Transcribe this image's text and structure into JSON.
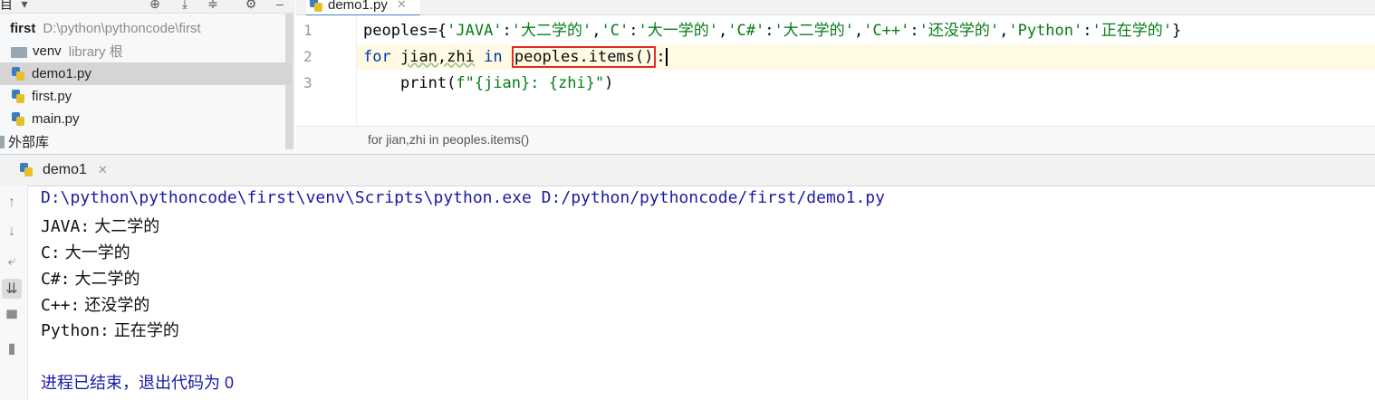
{
  "sidebar": {
    "title_fragment": "项目",
    "items": [
      {
        "label": "first",
        "path": "D:\\python\\pythoncode\\first",
        "type": "project-root"
      },
      {
        "label": "venv",
        "note": "library 根",
        "type": "folder"
      },
      {
        "label": "demo1.py",
        "type": "python-file",
        "selected": true
      },
      {
        "label": "first.py",
        "type": "python-file"
      },
      {
        "label": "main.py",
        "type": "python-file"
      },
      {
        "label": "外部库",
        "type": "external-libraries"
      }
    ],
    "toolbar_icons": [
      "locate-icon",
      "collapse-icon",
      "expand-icon",
      "gear-icon",
      "minimize-icon"
    ]
  },
  "editor": {
    "tab_label": "demo1.py",
    "line_numbers": [
      "1",
      "2",
      "3"
    ],
    "lines": {
      "l1": {
        "var": "peoples={",
        "k1": "'JAVA'",
        "v1": "'大二学的'",
        "k2": "'C'",
        "v2": "'大一学的'",
        "k3": "'C#'",
        "v3": "'大二学的'",
        "k4": "'C++'",
        "v4": "'还没学的'",
        "k5": "'Python'",
        "v5": "'正在学的'",
        "end": "}"
      },
      "l2": {
        "kw_for": "for",
        "vars": "jian,zhi",
        "kw_in": "in",
        "highlight": "peoples.items()",
        "end": ":"
      },
      "l3": {
        "indent": "    ",
        "call": "print(",
        "fstring": "f\"{jian}: {zhi}\"",
        "end": ")"
      }
    },
    "breadcrumb": "for jian,zhi in peoples.items()"
  },
  "run_panel": {
    "tab_label": "demo1",
    "command": "D:\\python\\pythoncode\\first\\venv\\Scripts\\python.exe D:/python/pythoncode/first/demo1.py",
    "output": [
      {
        "key": "JAVA:",
        "value": "大二学的"
      },
      {
        "key": "C:",
        "value": "大一学的"
      },
      {
        "key": "C#:",
        "value": "大二学的"
      },
      {
        "key": "C++:",
        "value": "还没学的"
      },
      {
        "key": "Python:",
        "value": "正在学的"
      }
    ],
    "exit_message": "进程已结束，退出代码为 0",
    "tool_icons": [
      "up-arrow-icon",
      "down-arrow-icon",
      "soft-wrap-icon",
      "scroll-to-end-icon",
      "print-icon",
      "trash-icon"
    ]
  },
  "colors": {
    "keyword": "#0033b3",
    "string": "#067d17",
    "highlight_box": "#e02b2b",
    "current_line": "#fffae3",
    "console_path": "#1a1aa6"
  }
}
